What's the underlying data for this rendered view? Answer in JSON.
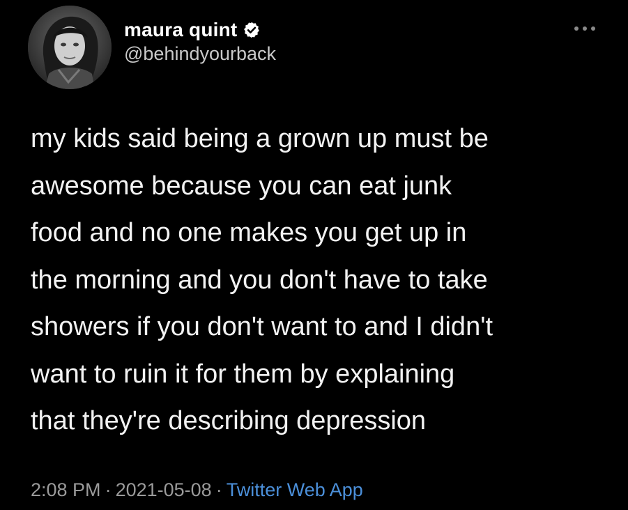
{
  "author": {
    "display_name": "maura quint",
    "handle": "@behindyourback",
    "verified": true
  },
  "tweet": {
    "text": "my kids said being a grown up must be\nawesome because you can eat junk\nfood and no one makes you get up in\nthe morning and you don't have to take\nshowers if you don't want to and I didn't\nwant to ruin it for them by explaining\nthat they're describing depression"
  },
  "meta": {
    "time": "2:08 PM",
    "separator": "·",
    "date": "2021-05-08",
    "source": "Twitter Web App"
  },
  "icons": {
    "verified": "verified-badge-icon",
    "more": "more-options-icon"
  },
  "colors": {
    "background": "#000000",
    "text": "#f2f2f2",
    "muted": "#9a9a9a",
    "link": "#4b8fd9"
  }
}
